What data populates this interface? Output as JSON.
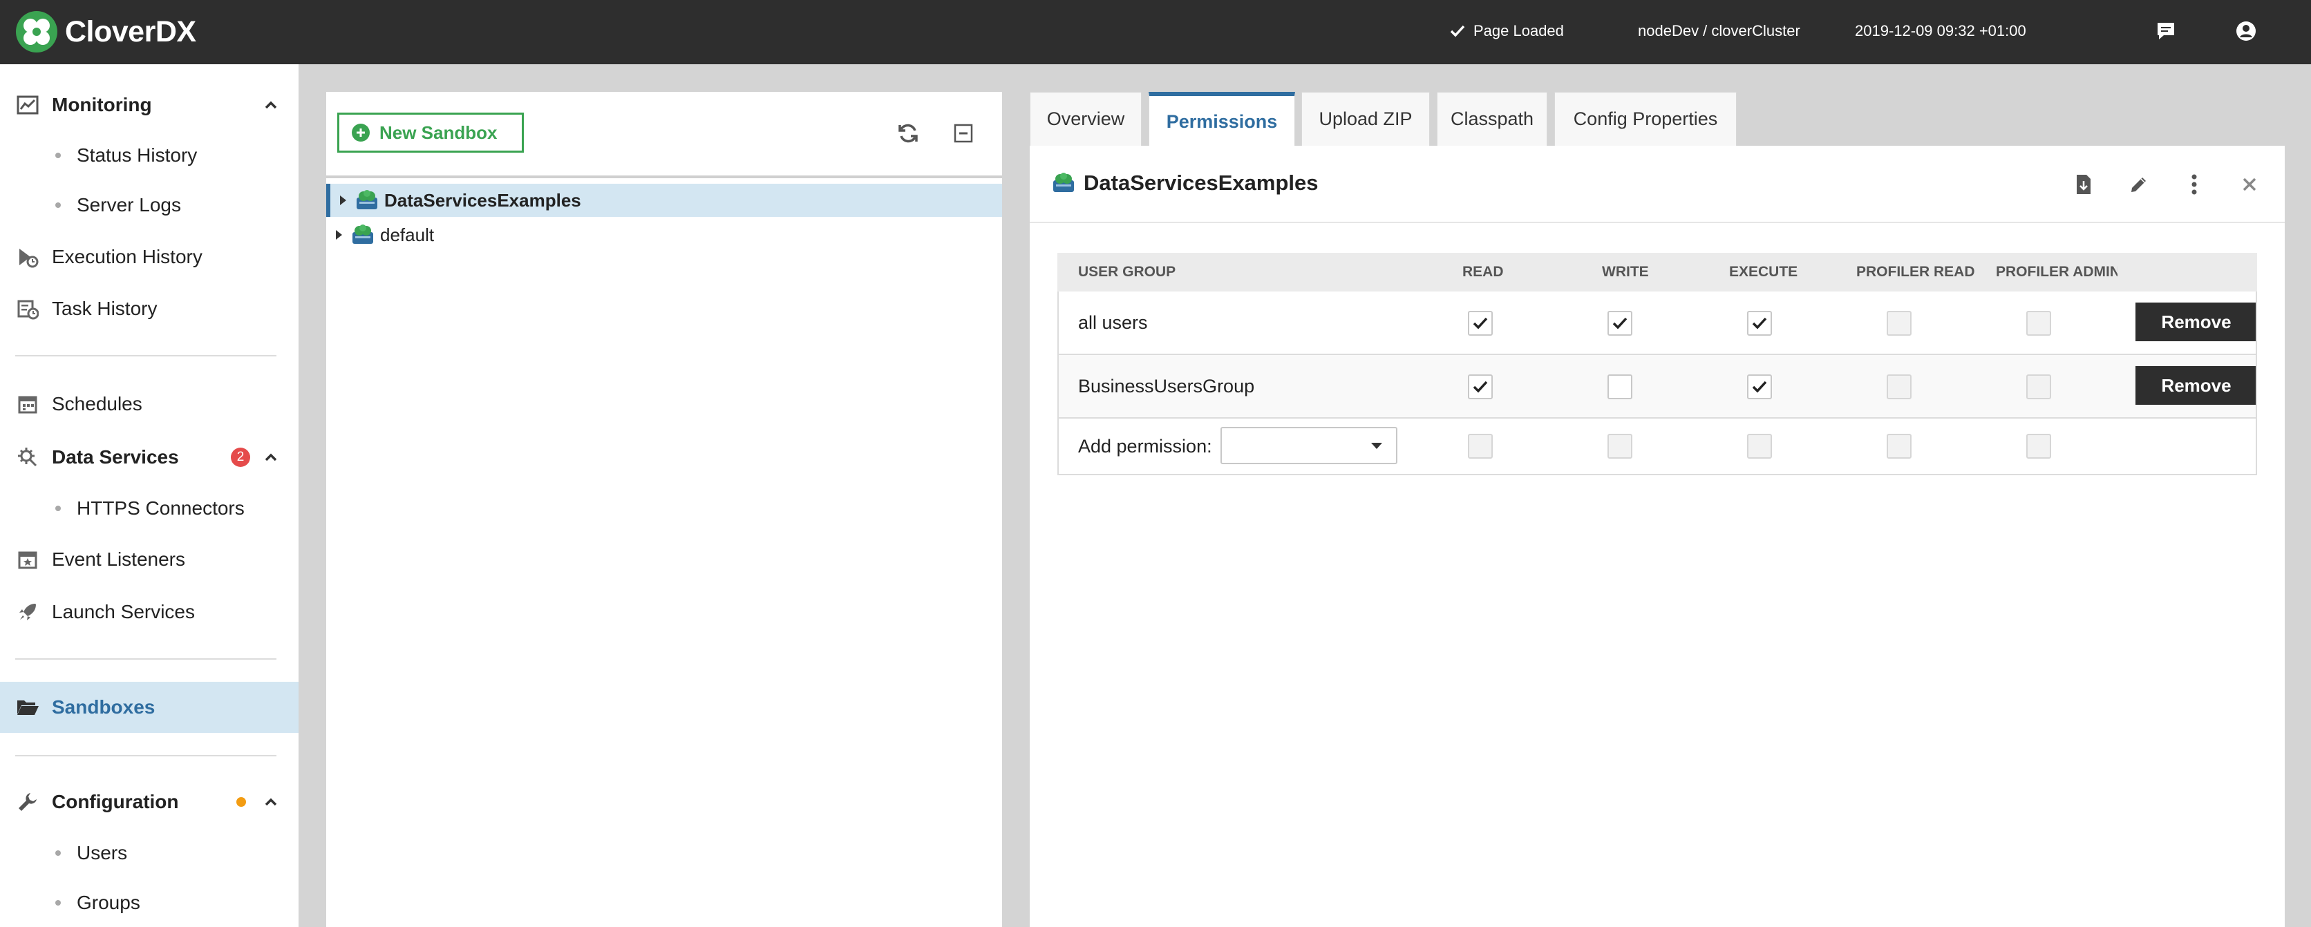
{
  "app": {
    "brand": "CloverDX",
    "status_text": "Page Loaded",
    "node_text": "nodeDev / cloverCluster",
    "timestamp": "2019-12-09 09:32 +01:00",
    "icons": {
      "status": "check-icon",
      "messages": "chat-icon",
      "user": "user-circle-icon"
    }
  },
  "colors": {
    "topbar": "#2e2e2e",
    "accent_green": "#3aa351",
    "accent_blue": "#2f6da0",
    "badge_red": "#e54b4b",
    "badge_orange": "#f39c12",
    "selected_bg": "#d3e6f2"
  },
  "sidebar": {
    "monitoring": "Monitoring",
    "status_history": "Status History",
    "server_logs": "Server Logs",
    "execution_history": "Execution History",
    "task_history": "Task History",
    "schedules": "Schedules",
    "data_services": "Data Services",
    "data_services_badge": "2",
    "https_connectors": "HTTPS Connectors",
    "event_listeners": "Event Listeners",
    "launch_services": "Launch Services",
    "sandboxes": "Sandboxes",
    "configuration": "Configuration",
    "users": "Users",
    "groups": "Groups"
  },
  "tree": {
    "new_sandbox_label": "New Sandbox",
    "items": [
      {
        "label": "DataServicesExamples",
        "selected": true
      },
      {
        "label": "default",
        "selected": false
      }
    ]
  },
  "tabs": [
    {
      "label": "Overview"
    },
    {
      "label": "Permissions",
      "active": true
    },
    {
      "label": "Upload ZIP"
    },
    {
      "label": "Classpath"
    },
    {
      "label": "Config Properties"
    }
  ],
  "detail": {
    "title": "DataServicesExamples",
    "columns": [
      "USER GROUP",
      "READ",
      "WRITE",
      "EXECUTE",
      "PROFILER READ",
      "PROFILER ADMIN"
    ],
    "rows": [
      {
        "group": "all users",
        "read": true,
        "write": true,
        "execute": true,
        "profiler_read": false,
        "profiler_admin": false,
        "action": "Remove"
      },
      {
        "group": "BusinessUsersGroup",
        "read": true,
        "write": false,
        "execute": true,
        "profiler_read": false,
        "profiler_admin": false,
        "action": "Remove"
      }
    ],
    "add_permission_label": "Add permission:",
    "add_permission_value": ""
  }
}
